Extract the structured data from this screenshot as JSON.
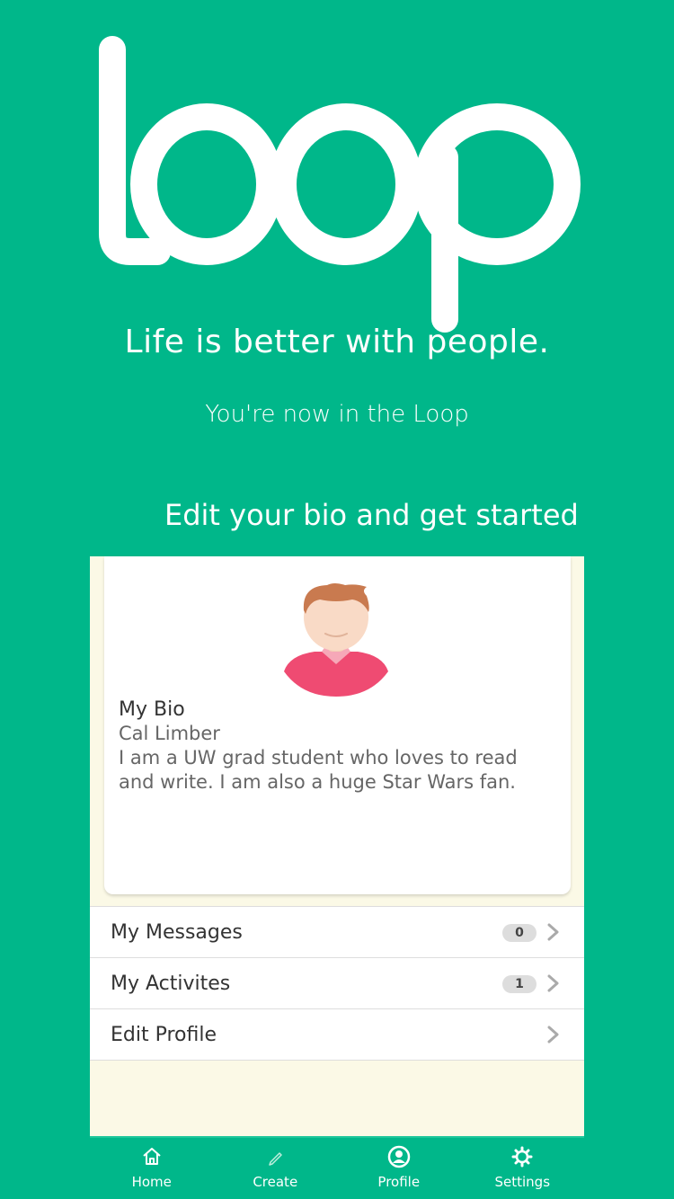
{
  "logo": {
    "text": "Loop"
  },
  "tagline": "Life is better with people.",
  "subtagline": "You're now in the Loop",
  "cta": "Edit your bio and get started",
  "bio": {
    "title": "My Bio",
    "name": "Cal Limber",
    "text": "I am a UW grad student who loves to read and write. I am also a huge Star Wars fan."
  },
  "menu": [
    {
      "label": "My Messages",
      "badge": "0",
      "icon": "chevron-right-icon"
    },
    {
      "label": "My Activites",
      "badge": "1",
      "icon": "chevron-right-icon"
    },
    {
      "label": "Edit Profile",
      "badge": null,
      "icon": "chevron-right-icon"
    }
  ],
  "tabs": [
    {
      "label": "Home",
      "icon": "home-icon"
    },
    {
      "label": "Create",
      "icon": "pencil-icon"
    },
    {
      "label": "Profile",
      "icon": "profile-icon"
    },
    {
      "label": "Settings",
      "icon": "gear-icon"
    }
  ],
  "colors": {
    "brand": "#00b78a",
    "panel": "#fbf9e6",
    "text": "#333333",
    "muted": "#666666",
    "badge": "#dddddd"
  }
}
